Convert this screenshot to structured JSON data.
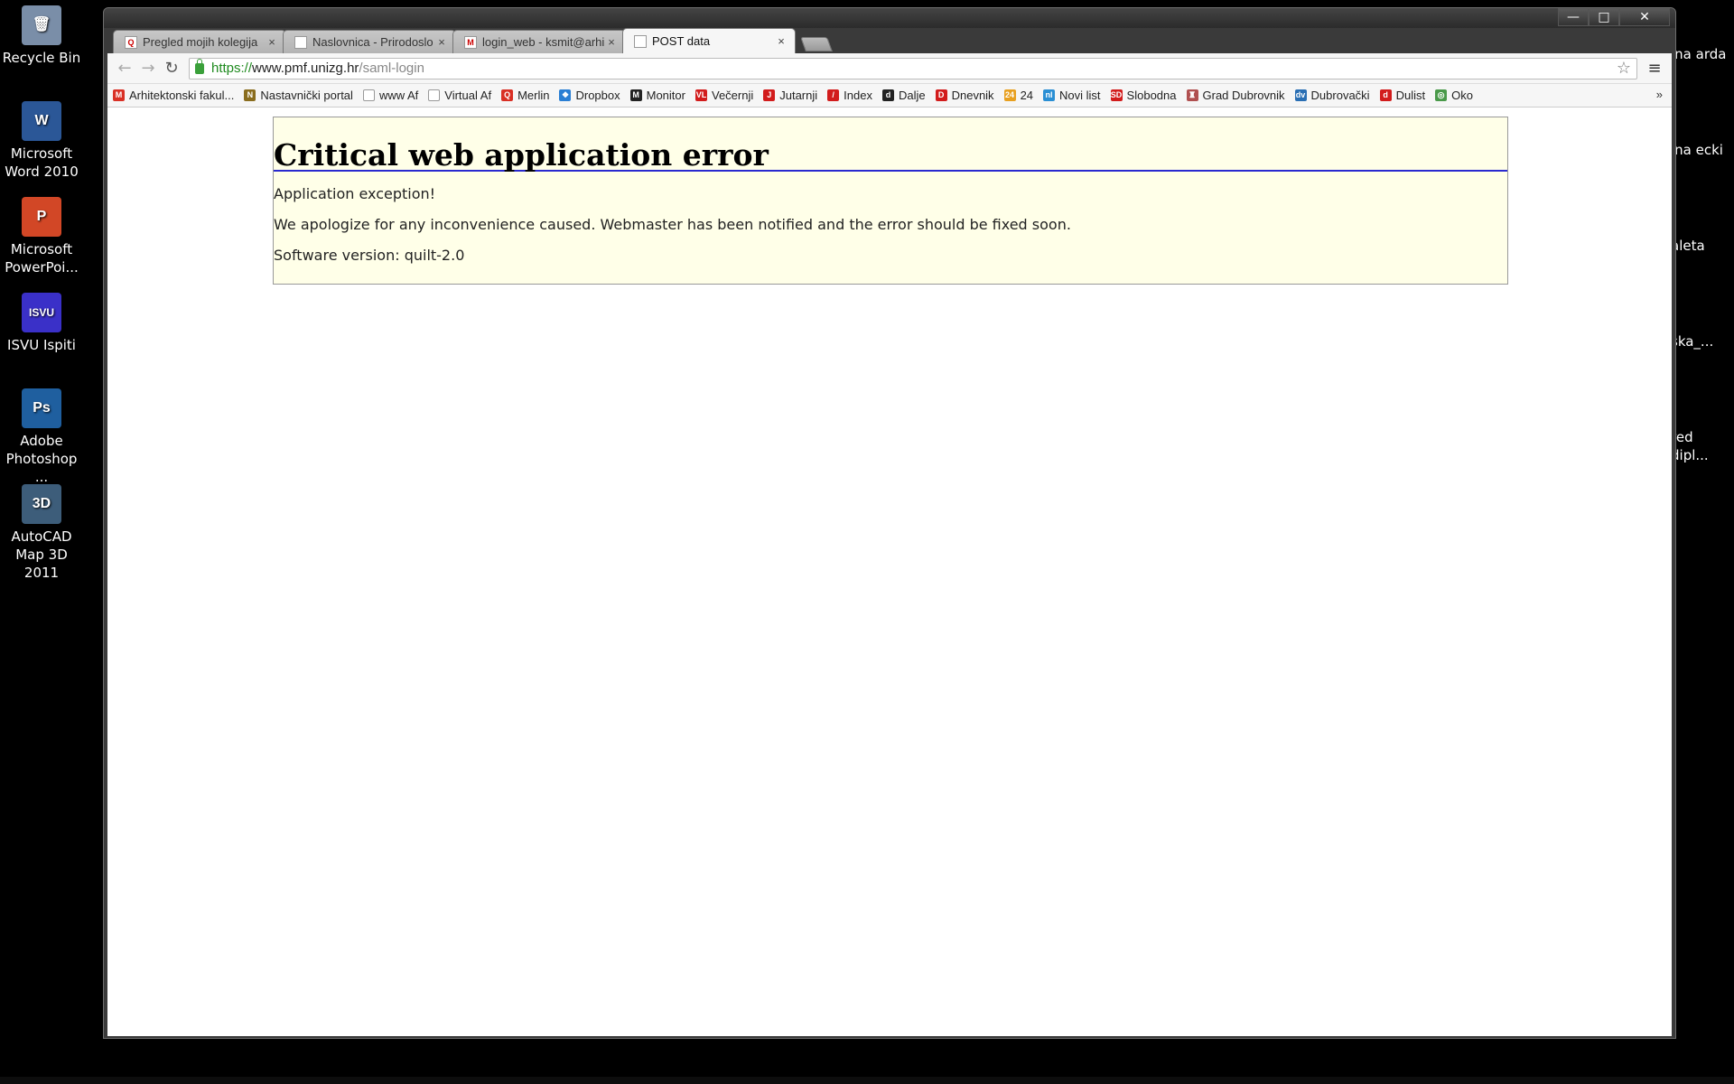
{
  "desktop": {
    "left_icons": [
      {
        "name": "recycle-bin",
        "label": "Recycle Bin",
        "glyph": "🗑",
        "color": "#7a8ea8"
      },
      {
        "name": "word-2010",
        "label": "Microsoft Word 2010",
        "glyph": "W",
        "color": "#2b5797"
      },
      {
        "name": "powerpoint",
        "label": "Microsoft PowerPoi...",
        "glyph": "P",
        "color": "#d24726"
      },
      {
        "name": "isvu-ispiti",
        "label": "ISVU Ispiti",
        "glyph": "ISVU",
        "color": "#3a30c8"
      },
      {
        "name": "photoshop",
        "label": "Adobe Photoshop ...",
        "glyph": "Ps",
        "color": "#1f5f9f"
      },
      {
        "name": "autocad",
        "label": "AutoCAD Map 3D 2011",
        "glyph": "3D",
        "color": "#3d5d7a"
      }
    ],
    "right_icons": [
      {
        "name": "right-icon-1",
        "label": "ina arda"
      },
      {
        "name": "right-icon-2",
        "label": "ina ecki"
      },
      {
        "name": "right-icon-3",
        "label": "aleta"
      },
      {
        "name": "right-icon-4",
        "label": "ska_..."
      },
      {
        "name": "right-icon-5",
        "label": "red dipl..."
      }
    ]
  },
  "window": {
    "controls": {
      "minimize": "—",
      "maximize": "□",
      "close": "✕"
    }
  },
  "tabs": [
    {
      "label": "Pregled mojih kolegija",
      "favicon": "Q",
      "active": false,
      "close": "×"
    },
    {
      "label": "Naslovnica - Prirodoslo",
      "favicon": "",
      "active": false,
      "close": "×"
    },
    {
      "label": "login_web - ksmit@arhi",
      "favicon": "M",
      "active": false,
      "close": "×"
    },
    {
      "label": "POST data",
      "favicon": "",
      "active": true,
      "close": "×"
    }
  ],
  "toolbar": {
    "back": "←",
    "forward": "→",
    "reload": "↻",
    "url_scheme": "https://",
    "url_host": "www.pmf.unizg.hr",
    "url_path": "/saml-login",
    "star": "☆",
    "menu": "≡"
  },
  "bookmarks": [
    {
      "label": "Arhitektonski fakul...",
      "icon": "M",
      "color": "#d93025"
    },
    {
      "label": "Nastavnički portal",
      "icon": "N",
      "color": "#8a6d1e"
    },
    {
      "label": "www Af",
      "icon": "",
      "color": "#ffffff"
    },
    {
      "label": "Virtual Af",
      "icon": "",
      "color": "#ffffff"
    },
    {
      "label": "Merlin",
      "icon": "Q",
      "color": "#d93025"
    },
    {
      "label": "Dropbox",
      "icon": "❖",
      "color": "#2a7fd4"
    },
    {
      "label": "Monitor",
      "icon": "M",
      "color": "#222222"
    },
    {
      "label": "Večernji",
      "icon": "VL",
      "color": "#d21c1c"
    },
    {
      "label": "Jutarnji",
      "icon": "J",
      "color": "#d21c1c"
    },
    {
      "label": "Index",
      "icon": "/",
      "color": "#d21c1c"
    },
    {
      "label": "Dalje",
      "icon": "d",
      "color": "#222222"
    },
    {
      "label": "Dnevnik",
      "icon": "D",
      "color": "#d21c1c"
    },
    {
      "label": "24",
      "icon": "24",
      "color": "#e8a020"
    },
    {
      "label": "Novi list",
      "icon": "nl",
      "color": "#2a8fd4"
    },
    {
      "label": "Slobodna",
      "icon": "SD",
      "color": "#d21c1c"
    },
    {
      "label": "Grad Dubrovnik",
      "icon": "♜",
      "color": "#b05050"
    },
    {
      "label": "Dubrovački",
      "icon": "dv",
      "color": "#2a6fb4"
    },
    {
      "label": "Dulist",
      "icon": "d",
      "color": "#d21c1c"
    },
    {
      "label": "Oko",
      "icon": "◎",
      "color": "#4a9a4a"
    }
  ],
  "bookmarks_more": "»",
  "page": {
    "heading": "Critical web application error",
    "line1": "Application exception!",
    "line2": "We apologize for any inconvenience caused. Webmaster has been notified and the error should be fixed soon.",
    "line3": "Software version: quilt-2.0"
  }
}
